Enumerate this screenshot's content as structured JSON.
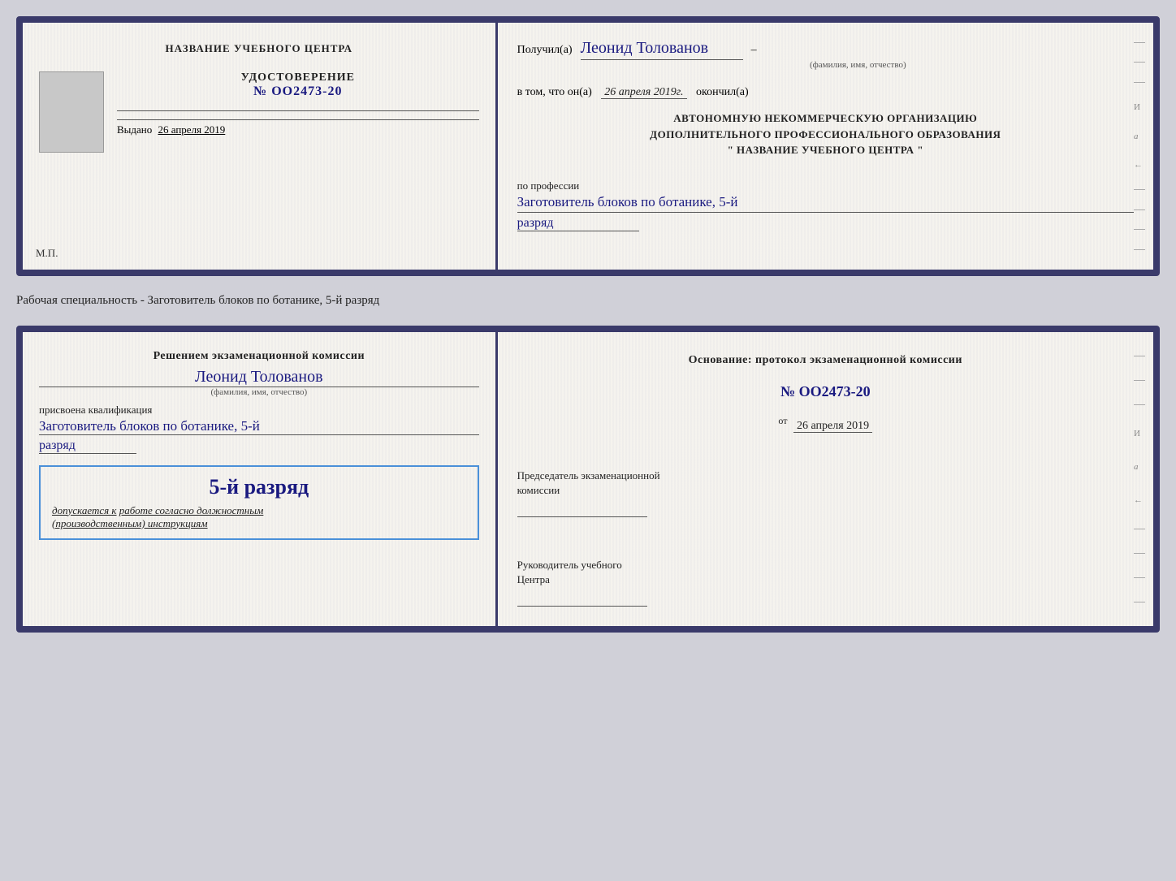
{
  "card1": {
    "left": {
      "institution": "НАЗВАНИЕ УЧЕБНОГО ЦЕНТРА",
      "cert_title": "УДОСТОВЕРЕНИЕ",
      "cert_number": "№ OO2473-20",
      "issued_label": "Выдано",
      "issued_date": "26 апреля 2019",
      "mp_label": "М.П."
    },
    "right": {
      "received_prefix": "Получил(а)",
      "recipient_name": "Леонид Толованов",
      "fio_hint": "(фамилия, имя, отчество)",
      "date_prefix": "в том, что он(а)",
      "date_value": "26 апреля 2019г.",
      "date_suffix": "окончил(а)",
      "org_line1": "АВТОНОМНУЮ НЕКОММЕРЧЕСКУЮ ОРГАНИЗАЦИЮ",
      "org_line2": "ДОПОЛНИТЕЛЬНОГО ПРОФЕССИОНАЛЬНОГО ОБРАЗОВАНИЯ",
      "org_line3": "\"  НАЗВАНИЕ УЧЕБНОГО ЦЕНТРА  \"",
      "profession_label": "по профессии",
      "profession_value": "Заготовитель блоков по ботанике, 5-й",
      "razryad_value": "разряд"
    }
  },
  "specialty_label": "Рабочая специальность - Заготовитель блоков по ботанике, 5-й разряд",
  "card2": {
    "left": {
      "decision_text": "Решением экзаменационной комиссии",
      "name": "Леонид Толованов",
      "fio_hint": "(фамилия, имя, отчество)",
      "assigned_label": "присвоена квалификация",
      "qualification_value": "Заготовитель блоков по ботанике, 5-й",
      "razryad_value": "разряд",
      "badge_title": "5-й разряд",
      "badge_subtitle_prefix": "допускается к",
      "badge_subtitle_underlined": "работе согласно должностным",
      "badge_subtitle_italic": "(производственным) инструкциям"
    },
    "right": {
      "basis_label": "Основание: протокол экзаменационной комиссии",
      "protocol_number": "№  OO2473-20",
      "from_label": "от",
      "from_date": "26 апреля 2019",
      "chairman_line1": "Председатель экзаменационной",
      "chairman_line2": "комиссии",
      "director_line1": "Руководитель учебного",
      "director_line2": "Центра"
    }
  }
}
